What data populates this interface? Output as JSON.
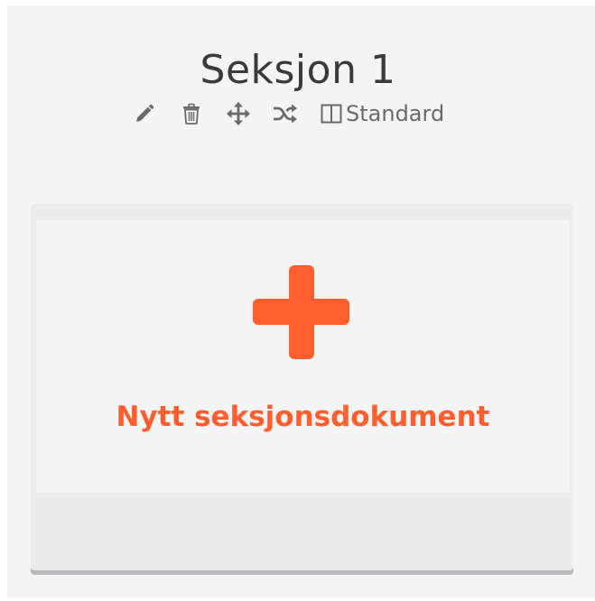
{
  "section": {
    "title": "Seksjon 1",
    "layout_label": "Standard"
  },
  "toolbar": {
    "icons": [
      "pencil-icon",
      "trash-icon",
      "move-icon",
      "shuffle-icon",
      "columns-icon"
    ]
  },
  "new_document": {
    "label": "Nytt seksjonsdokument",
    "icon": "plus-icon"
  },
  "colors": {
    "accent": "#ff5f2e",
    "icon_gray": "#6a6a6a",
    "panel_bg": "#f4f4f4"
  }
}
